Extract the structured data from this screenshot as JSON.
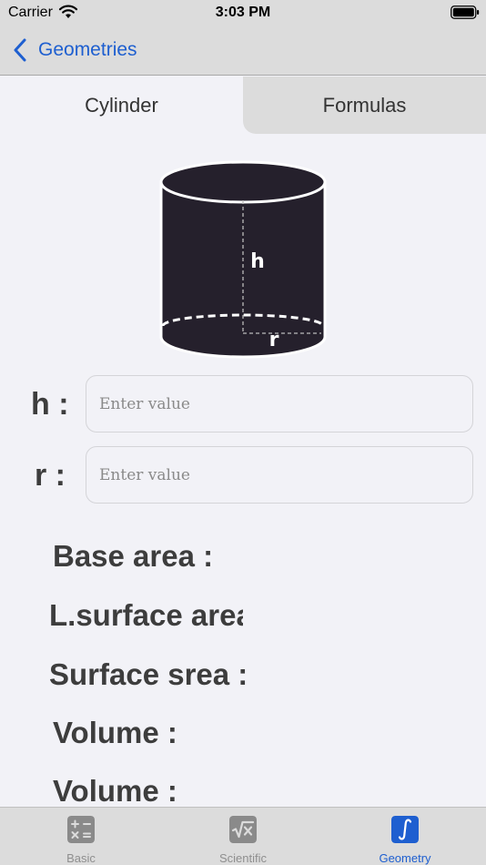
{
  "status_bar": {
    "carrier": "Carrier",
    "time": "3:03 PM"
  },
  "nav": {
    "back_label": "Geometries"
  },
  "tabs": [
    {
      "label": "Cylinder",
      "active": true
    },
    {
      "label": "Formulas",
      "active": false
    }
  ],
  "diagram": {
    "height_label": "h",
    "radius_label": "r"
  },
  "inputs": [
    {
      "label": "h :",
      "placeholder": "Enter value",
      "value": ""
    },
    {
      "label": "r :",
      "placeholder": "Enter value",
      "value": ""
    }
  ],
  "results": [
    "Base area :",
    "L.surface area :",
    "Surface srea :",
    "Volume :",
    "Volume :"
  ],
  "tab_bar": {
    "items": [
      {
        "label": "Basic",
        "icon": "calculator-icon",
        "active": false
      },
      {
        "label": "Scientific",
        "icon": "square-root-icon",
        "active": false
      },
      {
        "label": "Geometry",
        "icon": "integral-icon",
        "active": true
      }
    ]
  },
  "colors": {
    "accent": "#1e5fd0",
    "cylinder": "#25202c",
    "bar_background": "#dcdcdc",
    "inactive_icon": "#8a8a8a"
  }
}
